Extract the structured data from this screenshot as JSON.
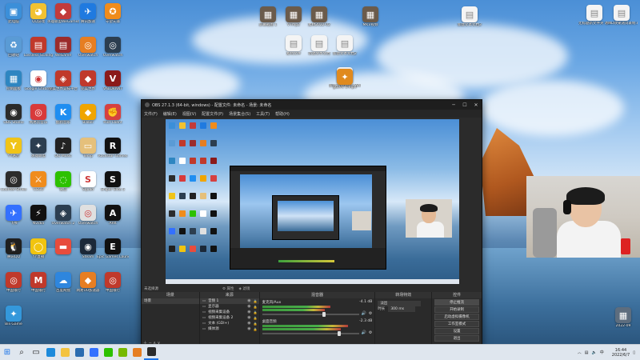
{
  "desktop": {
    "left_icons": [
      {
        "label": "此电脑",
        "color": "#3b8fd9",
        "glyph": "▣",
        "icon": "computer-icon"
      },
      {
        "label": "QQ游戏",
        "color": "#f1c232",
        "glyph": "◕",
        "icon": "qq-game-icon"
      },
      {
        "label": "英雄联盟WeGame版",
        "color": "#c23b3b",
        "glyph": "◆",
        "icon": "lol-icon"
      },
      {
        "label": "腾讯加速",
        "color": "#1f7ae0",
        "glyph": "✈",
        "icon": "accelerator-icon"
      },
      {
        "label": "守望先锋",
        "color": "#f08c1c",
        "glyph": "✪",
        "icon": "wegame-icon"
      },
      {
        "label": "回收站",
        "color": "#5a9bd5",
        "glyph": "♻",
        "icon": "recycle-bin-icon"
      },
      {
        "label": "Lossless Scaling",
        "color": "#c0392b",
        "glyph": "▤",
        "icon": "lossless-icon"
      },
      {
        "label": "WeGame",
        "color": "#9b2c2c",
        "glyph": "▤",
        "icon": "wegame-icon"
      },
      {
        "label": "Overwatch",
        "color": "#e67e22",
        "glyph": "◎",
        "icon": "overwatch-icon"
      },
      {
        "label": "Overwatch",
        "color": "#2c3e50",
        "glyph": "◎",
        "icon": "overwatch-icon"
      },
      {
        "label": "控制面板",
        "color": "#2e86c1",
        "glyph": "▦",
        "icon": "control-panel-icon"
      },
      {
        "label": "Google Chrome",
        "color": "#ffffff",
        "glyph": "◉",
        "icon": "chrome-icon"
      },
      {
        "label": "完美世界竞技平台",
        "color": "#c0392b",
        "glyph": "◈",
        "icon": "perfect-world-icon"
      },
      {
        "label": "完美世界",
        "color": "#c0392b",
        "glyph": "◆",
        "icon": "perfect-world-icon"
      },
      {
        "label": "VALORANT",
        "color": "#8b1a1a",
        "glyph": "V",
        "icon": "valorant-icon"
      },
      {
        "label": "OBS Studio",
        "color": "#2b2b2b",
        "glyph": "◉",
        "icon": "obs-icon"
      },
      {
        "label": "网易云音乐",
        "color": "#d83a3a",
        "glyph": "◎",
        "icon": "netease-music-icon"
      },
      {
        "label": "酷狗音乐",
        "color": "#1f8ef1",
        "glyph": "K",
        "icon": "kugou-icon"
      },
      {
        "label": "Bilibili",
        "color": "#f0a500",
        "glyph": "◆",
        "icon": "bilibili-icon"
      },
      {
        "label": "Riot Client",
        "color": "#d64040",
        "glyph": "✊",
        "icon": "riot-icon"
      },
      {
        "label": "YY语音",
        "color": "#f0c419",
        "glyph": "Y",
        "icon": "yy-icon"
      },
      {
        "label": "英雄联盟",
        "color": "#2c3e50",
        "glyph": "✦",
        "icon": "lol-icon"
      },
      {
        "label": "QQ Music",
        "color": "#222222",
        "glyph": "♪",
        "icon": "music-icon"
      },
      {
        "label": "Temp",
        "color": "#e5c07b",
        "glyph": "▭",
        "icon": "folder-icon"
      },
      {
        "label": "Rockstar Games",
        "color": "#111111",
        "glyph": "R",
        "icon": "rockstar-icon"
      },
      {
        "label": "Counter-Strike",
        "color": "#2c2c2c",
        "glyph": "◎",
        "icon": "csgo-icon"
      },
      {
        "label": "CSGO",
        "color": "#f08c1c",
        "glyph": "⚔",
        "icon": "csgo-icon"
      },
      {
        "label": "微信",
        "color": "#2dc100",
        "glyph": "◌",
        "icon": "wechat-icon"
      },
      {
        "label": "Squad",
        "color": "#ffffff",
        "glyph": "S",
        "icon": "squad-icon"
      },
      {
        "label": "Sniper Elite 5",
        "color": "#111111",
        "glyph": "S",
        "icon": "sniper-icon"
      },
      {
        "label": "飞书",
        "color": "#3370ff",
        "glyph": "✈",
        "icon": "feishu-icon"
      },
      {
        "label": "Nvidia",
        "color": "#111111",
        "glyph": "⚡",
        "icon": "nvidia-icon"
      },
      {
        "label": "Overwatch 2",
        "color": "#2c3e50",
        "glyph": "◈",
        "icon": "overwatch-icon"
      },
      {
        "label": "Overwatch",
        "color": "#e0e0e0",
        "glyph": "◎",
        "icon": "overwatch-icon"
      },
      {
        "label": "ARK",
        "color": "#111111",
        "glyph": "A",
        "icon": "ark-icon"
      },
      {
        "label": "腾讯QQ",
        "color": "#1f1f1f",
        "glyph": "🐧",
        "icon": "qq-icon"
      },
      {
        "label": "YY直播",
        "color": "#f1c40f",
        "glyph": "◯",
        "icon": "yy-icon"
      },
      {
        "label": "",
        "color": "#e74c3c",
        "glyph": "▬",
        "icon": "document-icon"
      },
      {
        "label": "Steam",
        "color": "#1b2838",
        "glyph": "◉",
        "icon": "steam-icon"
      },
      {
        "label": "Epic Games Launcher",
        "color": "#111111",
        "glyph": "E",
        "icon": "epic-icon"
      },
      {
        "label": "中国银行",
        "color": "#c0392b",
        "glyph": "◎",
        "icon": "bank-icon"
      },
      {
        "label": "中国银行",
        "color": "#c0392b",
        "glyph": "M",
        "icon": "bank-icon"
      },
      {
        "label": "百度网盘",
        "color": "#2e86de",
        "glyph": "☁",
        "icon": "baidu-pan-icon"
      },
      {
        "label": "网易UU加速器",
        "color": "#e67e22",
        "glyph": "◆",
        "icon": "uu-icon"
      },
      {
        "label": "中国银行",
        "color": "#c0392b",
        "glyph": "◎",
        "icon": "bank-icon"
      },
      {
        "label": "Bili Game",
        "color": "#3498db",
        "glyph": "✦",
        "icon": "game-icon"
      }
    ],
    "top_files": [
      {
        "label": "屏幕截图 1",
        "icon": "image-file-icon"
      },
      {
        "label": "VTmp2",
        "icon": "image-file-icon"
      },
      {
        "label": "素材2022-02",
        "icon": "image-file-icon"
      },
      {
        "label": "MKV视频",
        "icon": "video-file-icon"
      },
      {
        "label": "素材文件",
        "icon": "document-icon"
      },
      {
        "label": "新建文本文档",
        "icon": "document-icon"
      },
      {
        "label": "新建文本文档2",
        "icon": "document-icon"
      },
      {
        "label": "新建文本文档3",
        "icon": "document-icon"
      },
      {
        "label": "新建 Microsoft Word 文档",
        "icon": "document-icon"
      },
      {
        "label": "gtaVC 1.mp4",
        "icon": "video-file-icon"
      }
    ],
    "right_icons": [
      {
        "label": "无标题新文件夹 老哥测试.txt",
        "icon": "document-icon"
      },
      {
        "label": "AMD效果测试录制.mp4",
        "icon": "video-file-icon"
      }
    ],
    "bottom_right_file": {
      "label": "2022-09",
      "icon": "image-file-icon"
    }
  },
  "obs": {
    "title": "OBS 27.1.3 (64-bit, windows) - 配置文件: 未命名 - 场景: 未命名",
    "menu": [
      "文件(F)",
      "编辑(E)",
      "视图(V)",
      "配置文件(P)",
      "场景集合(S)",
      "工具(T)",
      "帮助(H)"
    ],
    "status_bar": "未选择源",
    "docks": {
      "scenes": {
        "header": "场景",
        "items": [
          "场景"
        ]
      },
      "sources": {
        "header": "来源",
        "items": [
          "音频 1",
          "显示器",
          "视频采集设备",
          "视频采集设备 2",
          "文本 (GDI+)",
          "媒体源"
        ]
      },
      "mixer": {
        "header": "混音器",
        "tracks": [
          {
            "name": "麦克风/Aux",
            "db": "-4.1 dB",
            "level": 0.62
          },
          {
            "name": "桌面音频",
            "db": "-2.3 dB",
            "level": 0.78
          }
        ]
      },
      "transitions": {
        "header": "转场特效",
        "type": "淡出",
        "duration_label": "时长",
        "duration": "300 ms"
      },
      "controls": {
        "header": "控件",
        "buttons": [
          "停止推流",
          "开始录制",
          "启动虚拟摄像机",
          "工作室模式",
          "设置",
          "退出"
        ]
      }
    }
  },
  "taskbar": {
    "apps": [
      {
        "name": "start-button",
        "glyph": "⊞",
        "color": "#1a73e8"
      },
      {
        "name": "search-icon",
        "glyph": "⌕",
        "color": "#222"
      },
      {
        "name": "taskview-icon",
        "glyph": "▭",
        "color": "#222"
      },
      {
        "name": "edge-icon",
        "color": "#1c8adb"
      },
      {
        "name": "explorer-icon",
        "color": "#f3c340"
      },
      {
        "name": "mail-icon",
        "color": "#2b6cb0"
      },
      {
        "name": "feishu-icon",
        "color": "#3370ff"
      },
      {
        "name": "wechat-icon",
        "color": "#2dc100"
      },
      {
        "name": "nvidia-icon",
        "color": "#76b900"
      },
      {
        "name": "photos-icon",
        "color": "#e67e22"
      },
      {
        "name": "obs-icon",
        "color": "#2b2b2b"
      }
    ],
    "time": "16:44",
    "date": "2022/6/7",
    "ime": "中"
  }
}
